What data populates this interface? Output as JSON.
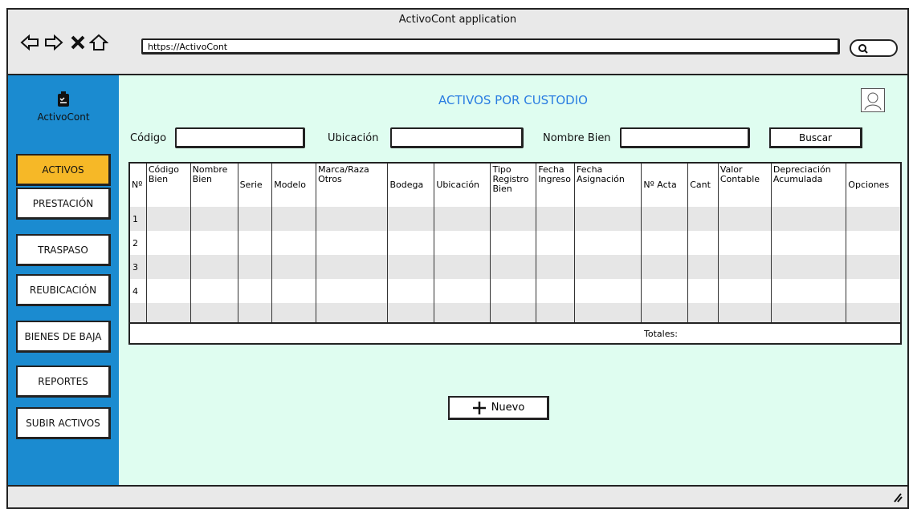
{
  "window": {
    "title": "ActivoCont application",
    "url": "https://ActivoCont"
  },
  "sidebar": {
    "logo_label": "ActivoCont",
    "items": [
      {
        "label": "ACTIVOS",
        "active": true
      },
      {
        "label": "PRESTACIÓN"
      },
      {
        "label": "TRASPASO"
      },
      {
        "label": "REUBICACIÓN"
      },
      {
        "label": "BIENES DE BAJA"
      },
      {
        "label": "REPORTES"
      },
      {
        "label": "SUBIR ACTIVOS"
      }
    ]
  },
  "main": {
    "title": "ACTIVOS POR CUSTODIO",
    "filters": {
      "codigo_label": "Código",
      "codigo_value": "",
      "ubicacion_label": "Ubicación",
      "ubicacion_value": "",
      "nombre_label": "Nombre Bien",
      "nombre_value": "",
      "search_button": "Buscar"
    },
    "table": {
      "columns": [
        "Nº",
        "Código Bien",
        "Nombre Bien",
        "Serie",
        "Modelo",
        "Marca/Raza Otros",
        "Bodega",
        "Ubicación",
        "Tipo Registro Bien",
        "Fecha Ingreso",
        "Fecha Asignación",
        "Nº Acta",
        "Cant",
        "Valor Contable",
        "Depreciación Acumulada",
        "Opciones"
      ],
      "rows": [
        {
          "n": "1"
        },
        {
          "n": "2"
        },
        {
          "n": "3"
        },
        {
          "n": "4"
        },
        {
          "n": ""
        }
      ],
      "totals_label": "Totales:"
    },
    "new_button": "Nuevo"
  },
  "colors": {
    "sidebar": "#1b8bd0",
    "active_item": "#f6b827",
    "main_bg": "#dffdf0",
    "title": "#2a7de1"
  }
}
